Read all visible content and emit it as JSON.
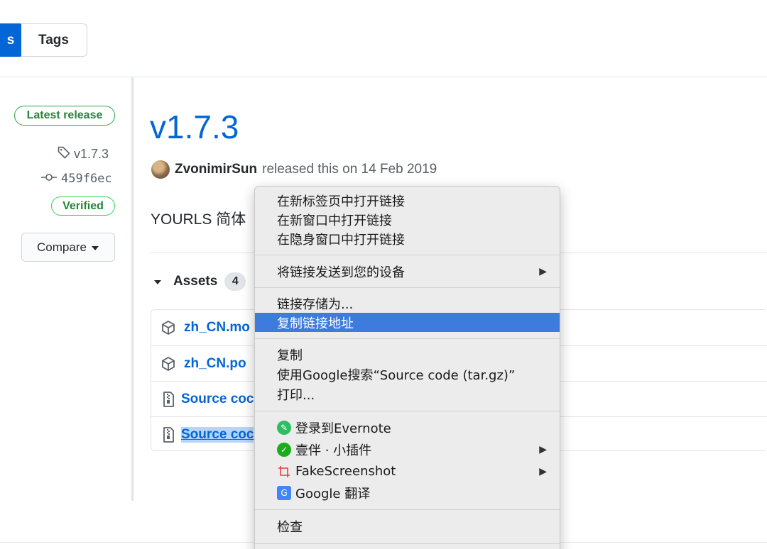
{
  "tabs": {
    "releases_label": "s",
    "tags_label": "Tags"
  },
  "sidebar": {
    "latest_release": "Latest release",
    "tag": "v1.7.3",
    "commit": "459f6ec",
    "verified": "Verified",
    "compare": "Compare"
  },
  "release": {
    "title": "v1.7.3",
    "author": "ZvonimirSun",
    "released_text": "released this on 14 Feb 2019",
    "description": "YOURLS 简体"
  },
  "assets": {
    "label": "Assets",
    "count": "4",
    "items": [
      {
        "name": "zh_CN.mo",
        "icon": "package-icon"
      },
      {
        "name": "zh_CN.po",
        "icon": "package-icon"
      },
      {
        "name": "Source coc",
        "icon": "file-zip-icon"
      },
      {
        "name": "Source coc",
        "icon": "file-zip-icon"
      }
    ]
  },
  "context_menu": {
    "items": [
      "在新标签页中打开链接",
      "在新窗口中打开链接",
      "在隐身窗口中打开链接",
      "将链接发送到您的设备",
      "链接存储为...",
      "复制链接地址",
      "复制",
      "使用Google搜索“Source code (tar.gz)”",
      "打印...",
      "登录到Evernote",
      "壹伴 · 小插件",
      "FakeScreenshot",
      "Google 翻译",
      "检查"
    ],
    "highlight_index": 5,
    "colors": {
      "highlight": "#3d7cdc",
      "evernote": "#2dbe60",
      "yiban": "#1aad19",
      "fakescreenshot": "#e0443e",
      "google_translate": "#4285f4"
    }
  },
  "colors": {
    "link": "#0366d6",
    "green": "#22863a"
  }
}
